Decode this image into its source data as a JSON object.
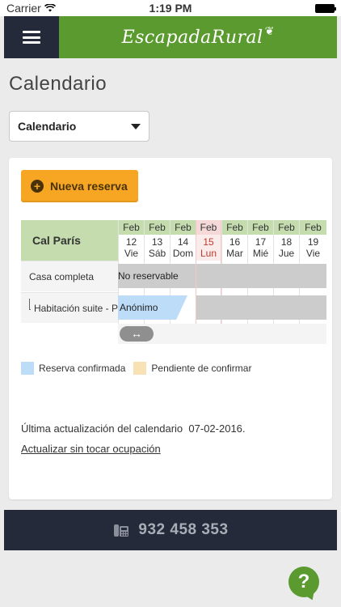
{
  "status_bar": {
    "carrier": "Carrier",
    "time": "1:19 PM"
  },
  "header": {
    "logo": "EscapadaRural"
  },
  "page": {
    "title": "Calendario"
  },
  "selector": {
    "value": "Calendario"
  },
  "card": {
    "new_button_label": "Nueva reserva",
    "calendar": {
      "property_name": "Cal París",
      "days": [
        {
          "month": "Feb",
          "num": "12",
          "weekday": "Vie"
        },
        {
          "month": "Feb",
          "num": "13",
          "weekday": "Sáb"
        },
        {
          "month": "Feb",
          "num": "14",
          "weekday": "Dom"
        },
        {
          "month": "Feb",
          "num": "15",
          "weekday": "Lun"
        },
        {
          "month": "Feb",
          "num": "16",
          "weekday": "Mar"
        },
        {
          "month": "Feb",
          "num": "17",
          "weekday": "Mié"
        },
        {
          "month": "Feb",
          "num": "18",
          "weekday": "Jue"
        },
        {
          "month": "Feb",
          "num": "19",
          "weekday": "Vie"
        }
      ],
      "today_index": 3,
      "rows": [
        {
          "label": "Casa completa",
          "bar_text": "No reservable"
        },
        {
          "label": "Habitación suite - P",
          "bar_text": "Anónimo"
        }
      ],
      "scroll_icon": "↔"
    },
    "legend": [
      {
        "label": "Reserva confirmada",
        "color": "#bcdcf8"
      },
      {
        "label": "Pendiente de confirmar",
        "color": "#f7e1b5"
      }
    ],
    "last_update_label": "Última actualización del calendario",
    "last_update_date": "07-02-2016",
    "last_update_suffix": ".",
    "update_link": "Actualizar sin tocar ocupación"
  },
  "footer": {
    "phone_icon": "phone-icon",
    "phone_number": "932 458 353"
  },
  "help": {
    "label": "?"
  },
  "colors": {
    "green": "#5a9a2f",
    "navy": "#252a3a",
    "orange": "#f6a623"
  }
}
